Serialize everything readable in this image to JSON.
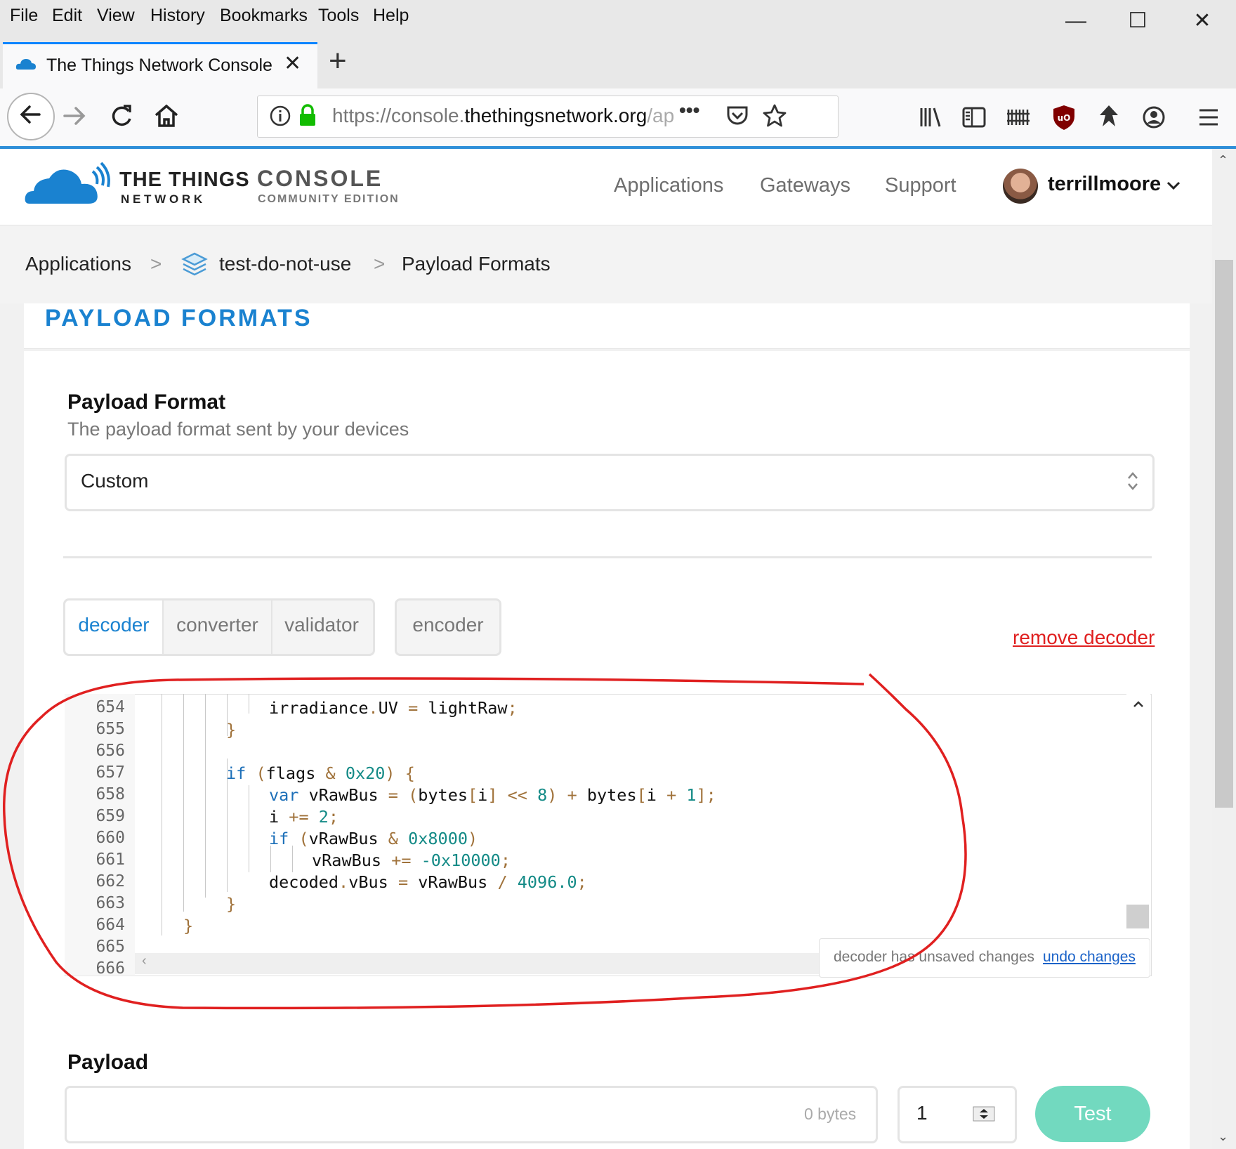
{
  "menubar": {
    "items": [
      "File",
      "Edit",
      "View",
      "History",
      "Bookmarks",
      "Tools",
      "Help"
    ]
  },
  "browser": {
    "tab_title": "The Things Network Console",
    "new_tab": "+",
    "url_prefix": "https://console.",
    "url_domain": "thethingsnetwork.org",
    "url_suffix": "/ap",
    "url_more": "•••"
  },
  "site": {
    "logo_line1": "THE THINGS",
    "logo_line2": "N E T W O R K",
    "console_title": "CONSOLE",
    "console_subtitle": "COMMUNITY EDITION",
    "nav": [
      "Applications",
      "Gateways",
      "Support"
    ],
    "username": "terrillmoore"
  },
  "breadcrumb": {
    "items": [
      "Applications",
      "test-do-not-use",
      "Payload Formats"
    ],
    "separator": ">"
  },
  "page": {
    "section_title": "PAYLOAD FORMATS",
    "format_label": "Payload Format",
    "format_help": "The payload format sent by your devices",
    "format_value": "Custom",
    "tabs": [
      "decoder",
      "converter",
      "validator"
    ],
    "encoder_tab": "encoder",
    "active_tab": "decoder",
    "remove_link": "remove decoder"
  },
  "editor": {
    "line_numbers": [
      "654",
      "655",
      "656",
      "657",
      "658",
      "659",
      "660",
      "661",
      "662",
      "663",
      "664",
      "665",
      "666"
    ],
    "unsaved_text": "decoder has unsaved changes",
    "undo_link": "undo changes"
  },
  "payload": {
    "label": "Payload",
    "bytes_placeholder": "0 bytes",
    "port_value": "1",
    "test_button": "Test"
  },
  "colors": {
    "brand_blue": "#1a82d0",
    "remove_red": "#e02020",
    "test_button": "#72d9bf",
    "annotation_red": "#e02020"
  }
}
